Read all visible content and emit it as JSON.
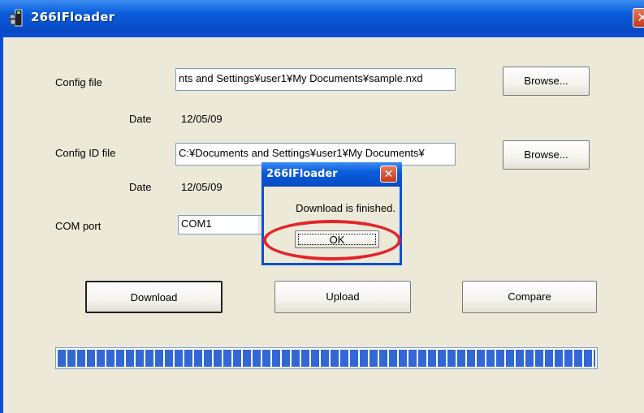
{
  "window": {
    "title": "266IFloader",
    "close_glyph": "✕"
  },
  "form": {
    "config_file": {
      "label": "Config file",
      "value": "nts and Settings¥user1¥My Documents¥sample.nxd",
      "browse_label": "Browse..."
    },
    "config_date": {
      "label": "Date",
      "value": "12/05/09"
    },
    "config_id_file": {
      "label": "Config ID file",
      "value": "C:¥Documents and Settings¥user1¥My Documents¥",
      "browse_label": "Browse..."
    },
    "id_date": {
      "label": "Date",
      "value": "12/05/09"
    },
    "com_port": {
      "label": "COM port",
      "value": "COM1"
    }
  },
  "buttons": {
    "download": "Download",
    "upload": "Upload",
    "compare": "Compare"
  },
  "progress": {
    "fraction": 1.0,
    "color": "#3168d5"
  },
  "dialog": {
    "title": "266IFloader",
    "message": "Download is finished.",
    "ok_label": "OK",
    "close_glyph": "✕"
  },
  "colors": {
    "titlebar": "#0a5ddb",
    "highlight": "#e4232b",
    "background": "#ece9d8"
  }
}
